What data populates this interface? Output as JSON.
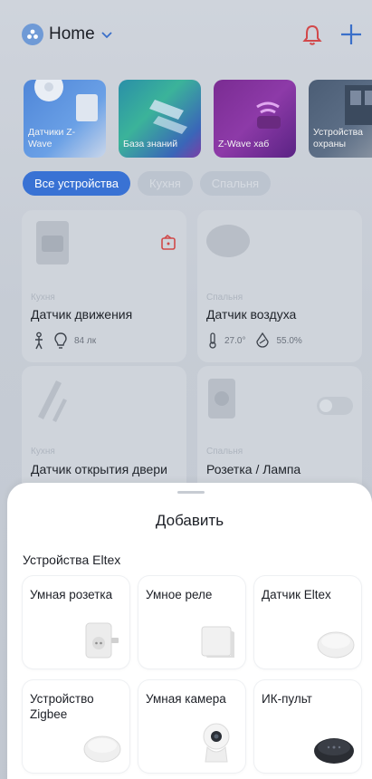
{
  "header": {
    "title": "Home"
  },
  "banners": [
    {
      "label": "Датчики Z-Wave"
    },
    {
      "label": "База знаний"
    },
    {
      "label": "Z-Wave хаб"
    },
    {
      "label": "Устройства охраны"
    }
  ],
  "filters": [
    {
      "label": "Все устройства",
      "active": true
    },
    {
      "label": "Кухня",
      "active": false
    },
    {
      "label": "Спальня",
      "active": false
    }
  ],
  "devices": [
    {
      "room": "Кухня",
      "name": "Датчик движения",
      "lux": "84 лк"
    },
    {
      "room": "Спальня",
      "name": "Датчик воздуха",
      "temperature": "27.0°",
      "humidity": "55.0%"
    },
    {
      "room": "Кухня",
      "name": "Датчик открытия двери"
    },
    {
      "room": "Спальня",
      "name": "Розетка / Лампа"
    }
  ],
  "sheet": {
    "title": "Добавить",
    "section": "Устройства Eltex",
    "tiles": [
      {
        "label": "Умная розетка",
        "icon": "smart-plug-icon"
      },
      {
        "label": "Умное реле",
        "icon": "relay-icon"
      },
      {
        "label": "Датчик Eltex",
        "icon": "sensor-icon"
      },
      {
        "label": "Устройство Zigbee",
        "icon": "zigbee-hub-icon"
      },
      {
        "label": "Умная камера",
        "icon": "camera-icon"
      },
      {
        "label": "ИК-пульт",
        "icon": "ir-remote-icon"
      }
    ]
  }
}
